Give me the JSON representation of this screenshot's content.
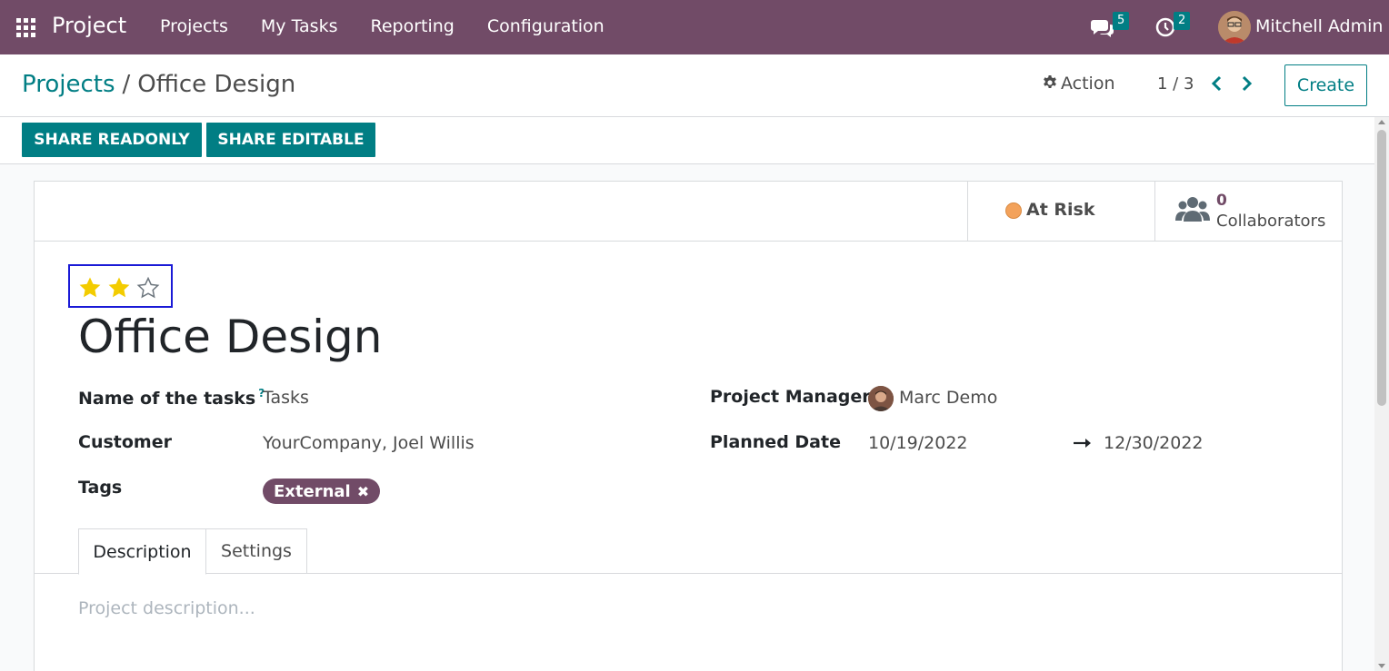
{
  "navbar": {
    "app_name": "Project",
    "menu": [
      "Projects",
      "My Tasks",
      "Reporting",
      "Configuration"
    ],
    "chat_count": "5",
    "activity_count": "2",
    "user_name": "Mitchell Admin",
    "bg_color": "#714b67"
  },
  "control_panel": {
    "breadcrumb_parent": "Projects",
    "breadcrumb_separator": "/",
    "breadcrumb_current": "Office Design",
    "action_label": "Action",
    "pager": "1 / 3",
    "create_label": "Create"
  },
  "statusbar": {
    "share_readonly": "SHARE READONLY",
    "share_editable": "SHARE EDITABLE"
  },
  "smart_buttons": {
    "status_label": "At Risk",
    "status_color": "#f3a25b",
    "collaborators_count": "0",
    "collaborators_label": "Collaborators"
  },
  "record": {
    "priority_stars": 2,
    "priority_max": 3,
    "title": "Office Design",
    "fields": {
      "tasks_label": "Name of the tasks",
      "tasks_help": "?",
      "tasks_value": "Tasks",
      "customer_label": "Customer",
      "customer_value": "YourCompany, Joel Willis",
      "tags_label": "Tags",
      "tag_value": "External",
      "manager_label": "Project Manager",
      "manager_value": "Marc Demo",
      "planned_label": "Planned Date",
      "planned_start": "10/19/2022",
      "planned_end": "12/30/2022"
    }
  },
  "tabs": [
    "Description",
    "Settings"
  ],
  "description_placeholder": "Project description...",
  "accent_color": "#017e84"
}
